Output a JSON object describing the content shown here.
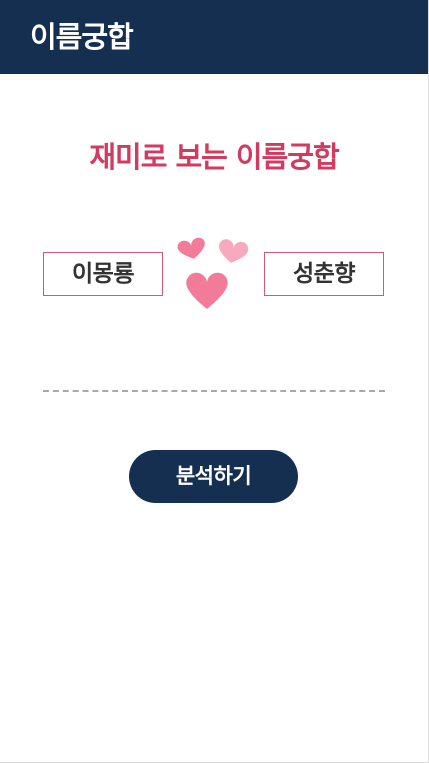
{
  "header": {
    "title": "이름궁합"
  },
  "main": {
    "subtitle": "재미로 보는 이름궁합",
    "name_left": "이몽룡",
    "name_right": "성춘향",
    "hearts_icon": "hearts-icon",
    "analyze_label": "분석하기"
  },
  "colors": {
    "header_bg": "#152f50",
    "accent_pink": "#d23b5f",
    "box_border": "#d6557a",
    "heart_pink": "#f27b99",
    "heart_light": "#f7aabd"
  }
}
